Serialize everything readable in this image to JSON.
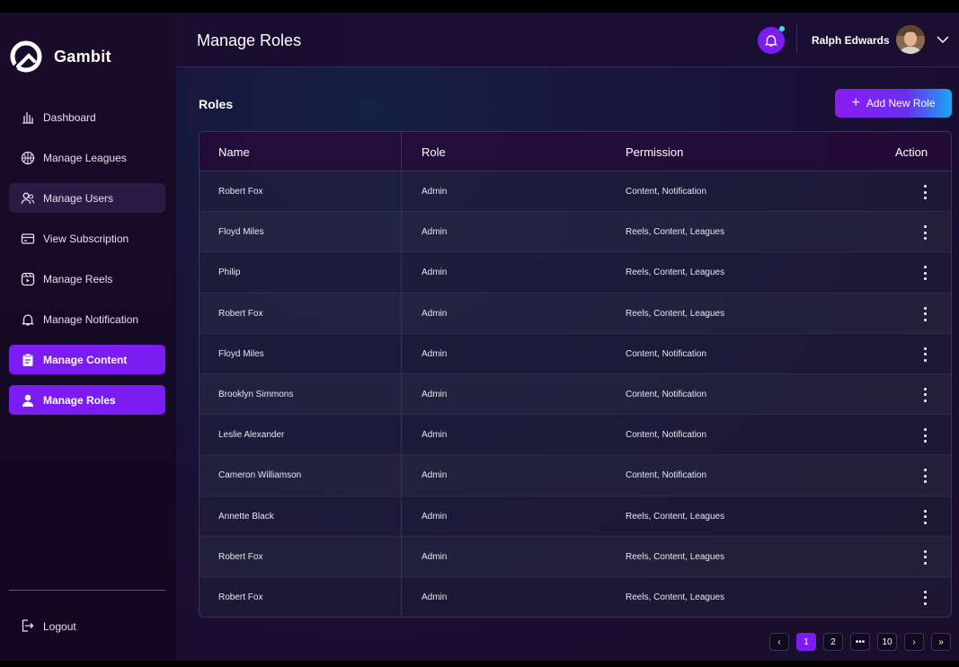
{
  "app": {
    "name": "Gambit"
  },
  "sidebar": {
    "items": [
      {
        "label": "Dashboard",
        "icon": "bar-chart-icon",
        "state": "normal"
      },
      {
        "label": "Manage Leagues",
        "icon": "basketball-icon",
        "state": "normal"
      },
      {
        "label": "Manage Users",
        "icon": "users-icon",
        "state": "hover"
      },
      {
        "label": "View Subscription",
        "icon": "card-icon",
        "state": "normal"
      },
      {
        "label": "Manage Reels",
        "icon": "reels-icon",
        "state": "normal"
      },
      {
        "label": "Manage Notification",
        "icon": "bell-icon",
        "state": "normal"
      },
      {
        "label": "Manage Content",
        "icon": "clipboard-icon",
        "state": "active"
      },
      {
        "label": "Manage Roles",
        "icon": "user-icon",
        "state": "active"
      }
    ],
    "logout_label": "Logout"
  },
  "header": {
    "title": "Manage Roles",
    "user_name": "Ralph Edwards"
  },
  "content": {
    "section_title": "Roles",
    "add_button_label": "Add New Role"
  },
  "table": {
    "columns": [
      "Name",
      "Role",
      "Permission",
      "Action"
    ],
    "rows": [
      {
        "name": "Robert Fox",
        "role": "Admin",
        "permission": "Content, Notification"
      },
      {
        "name": "Floyd Miles",
        "role": "Admin",
        "permission": "Reels, Content, Leagues"
      },
      {
        "name": "Philip",
        "role": "Admin",
        "permission": "Reels, Content, Leagues"
      },
      {
        "name": "Robert Fox",
        "role": "Admin",
        "permission": "Reels, Content, Leagues"
      },
      {
        "name": "Floyd Miles",
        "role": "Admin",
        "permission": "Content, Notification"
      },
      {
        "name": "Brooklyn Simmons",
        "role": "Admin",
        "permission": "Content, Notification"
      },
      {
        "name": "Leslie Alexander",
        "role": "Admin",
        "permission": "Content, Notification"
      },
      {
        "name": "Cameron Williamson",
        "role": "Admin",
        "permission": "Content, Notification"
      },
      {
        "name": "Annette Black",
        "role": "Admin",
        "permission": "Reels, Content, Leagues"
      },
      {
        "name": "Robert Fox",
        "role": "Admin",
        "permission": "Reels, Content, Leagues"
      },
      {
        "name": "Robert Fox",
        "role": "Admin",
        "permission": "Reels, Content, Leagues"
      }
    ]
  },
  "pagination": {
    "prev": "‹",
    "pages": [
      "1",
      "2",
      "•••",
      "10"
    ],
    "current": "1",
    "next": "›",
    "last": "»"
  },
  "colors": {
    "accent": "#7a1cf2",
    "notification_dot": "#2ee6f0"
  }
}
